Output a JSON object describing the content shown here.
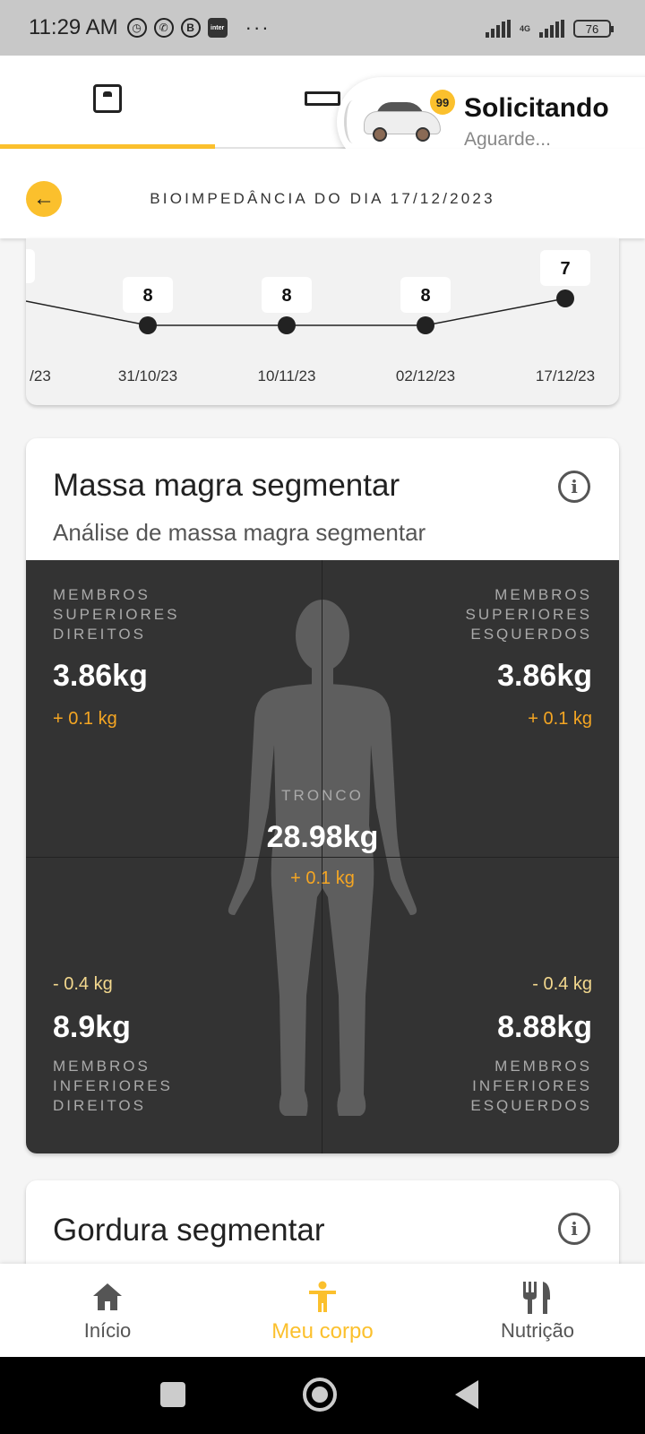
{
  "status_bar": {
    "time": "11:29 AM",
    "network": "4G",
    "battery": "76",
    "app_icons": [
      "alarm-icon",
      "whatsapp-icon",
      "b-icon",
      "inter-icon"
    ],
    "more": "···",
    "inter_label": "inter"
  },
  "header": {
    "tabs": [
      {
        "icon": "scale-icon",
        "active": true
      },
      {
        "icon": "ruler-icon",
        "active": false
      }
    ]
  },
  "ride_notification": {
    "badge": "99",
    "title": "Solicitando",
    "subtitle": "Aguarde..."
  },
  "subheader": {
    "title": "BIOIMPEDÂNCIA DO DIA 17/12/2023"
  },
  "chart_data": {
    "type": "line",
    "x": [
      "/23",
      "31/10/23",
      "10/11/23",
      "02/12/23",
      "17/12/23"
    ],
    "values": [
      null,
      8,
      8,
      8,
      7
    ],
    "data_labels": [
      "",
      "8",
      "8",
      "8",
      "7"
    ],
    "accent": "#222222"
  },
  "massa_magra": {
    "title": "Massa magra segmentar",
    "subtitle": "Análise de massa magra segmentar",
    "upper_right": {
      "label": "MEMBROS SUPERIORES DIREITOS",
      "value": "3.86kg",
      "delta": "+ 0.1 kg"
    },
    "upper_left": {
      "label": "MEMBROS SUPERIORES ESQUERDOS",
      "value": "3.86kg",
      "delta": "+ 0.1 kg"
    },
    "trunk": {
      "label": "TRONCO",
      "value": "28.98kg",
      "delta": "+ 0.1 kg"
    },
    "lower_right": {
      "label": "MEMBROS INFERIORES DIREITOS",
      "value": "8.9kg",
      "delta": "- 0.4 kg"
    },
    "lower_left": {
      "label": "MEMBROS INFERIORES ESQUERDOS",
      "value": "8.88kg",
      "delta": "- 0.4 kg"
    }
  },
  "gordura": {
    "title": "Gordura segmentar"
  },
  "bottom_nav": {
    "items": [
      {
        "label": "Início",
        "icon": "home-icon"
      },
      {
        "label": "Meu corpo",
        "icon": "body-icon"
      },
      {
        "label": "Nutrição",
        "icon": "cutlery-icon"
      }
    ],
    "active_color": "#fbc02d"
  }
}
